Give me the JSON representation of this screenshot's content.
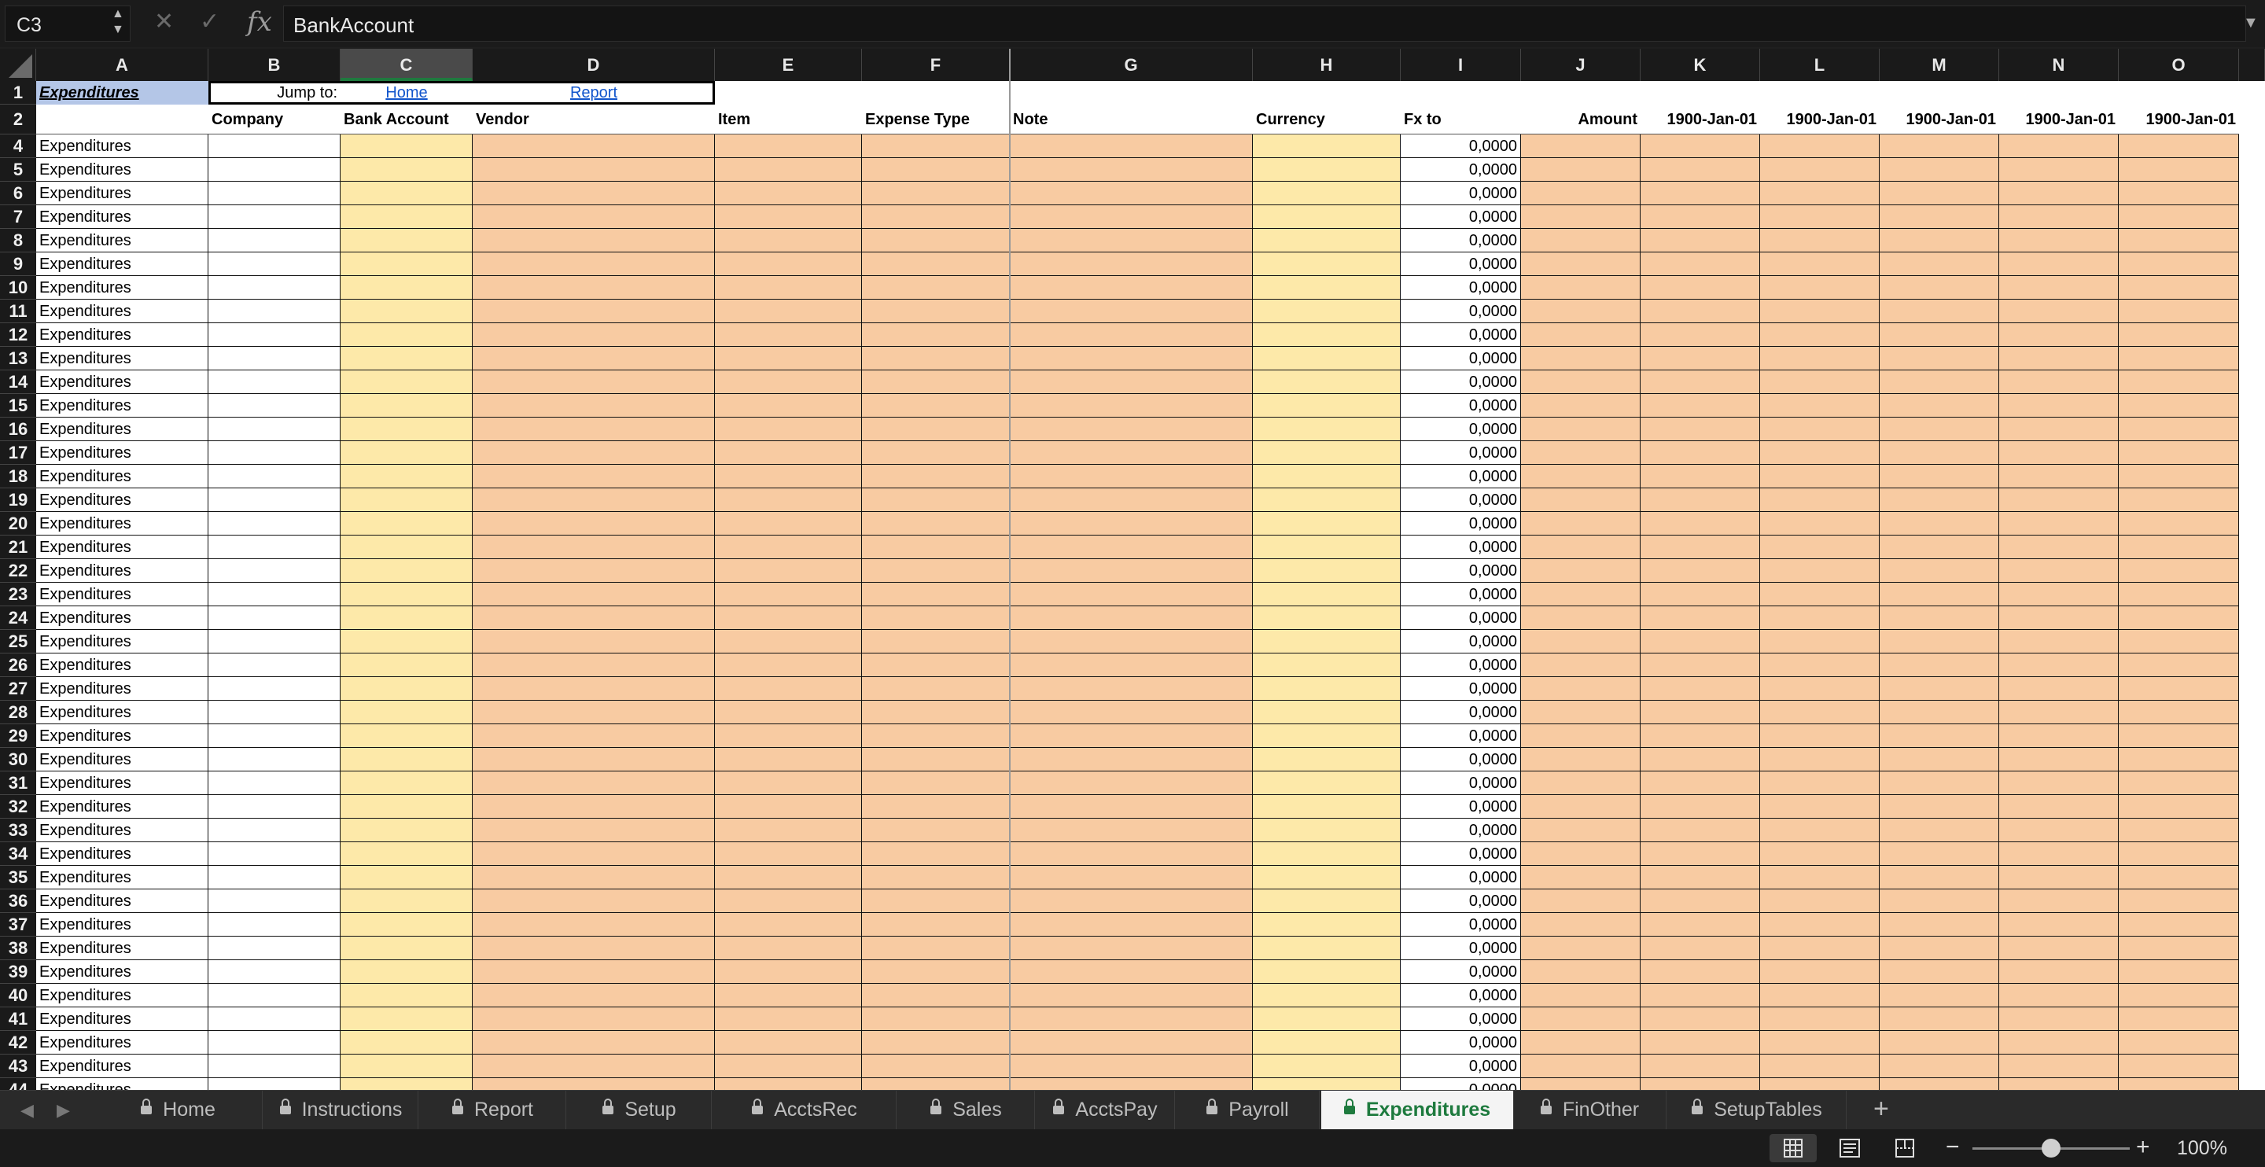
{
  "formula_bar": {
    "name_box": "C3",
    "formula": "BankAccount",
    "fx_label": "fx"
  },
  "columns": [
    "A",
    "B",
    "C",
    "D",
    "E",
    "F",
    "G",
    "H",
    "I",
    "J",
    "K",
    "L",
    "M",
    "N",
    "O"
  ],
  "selected_column": "C",
  "row1": {
    "title": "Expenditures",
    "jump_label": "Jump to:",
    "link_home": "Home",
    "link_report": "Report"
  },
  "headers": {
    "B": "Company",
    "C": "Bank Account",
    "D": "Vendor",
    "E": "Item",
    "F": "Expense Type",
    "G": "Note",
    "H": "Currency",
    "I": "Fx to",
    "J": "Amount",
    "K": "1900-Jan-01",
    "L": "1900-Jan-01",
    "M": "1900-Jan-01",
    "N": "1900-Jan-01",
    "O": "1900-Jan-01"
  },
  "data_rows": {
    "first": 4,
    "last": 44,
    "col_a_value": "Expenditures",
    "fx_value": "0,0000"
  },
  "sheet_tabs": [
    {
      "label": "Home",
      "locked": true
    },
    {
      "label": "Instructions",
      "locked": true
    },
    {
      "label": "Report",
      "locked": true
    },
    {
      "label": "Setup",
      "locked": true
    },
    {
      "label": "AcctsRec",
      "locked": true
    },
    {
      "label": "Sales",
      "locked": true
    },
    {
      "label": "AcctsPay",
      "locked": true
    },
    {
      "label": "Payroll",
      "locked": true
    },
    {
      "label": "Expenditures",
      "locked": true,
      "active": true
    },
    {
      "label": "FinOther",
      "locked": true
    },
    {
      "label": "SetupTables",
      "locked": true
    }
  ],
  "status": {
    "zoom": "100%",
    "zoom_fraction": 0.5
  },
  "colors": {
    "title_bg": "#b4c6e7",
    "bank_fill": "#fde9a9",
    "peach_fill": "#f8cba2",
    "active_tab_text": "#1e7a3e"
  }
}
